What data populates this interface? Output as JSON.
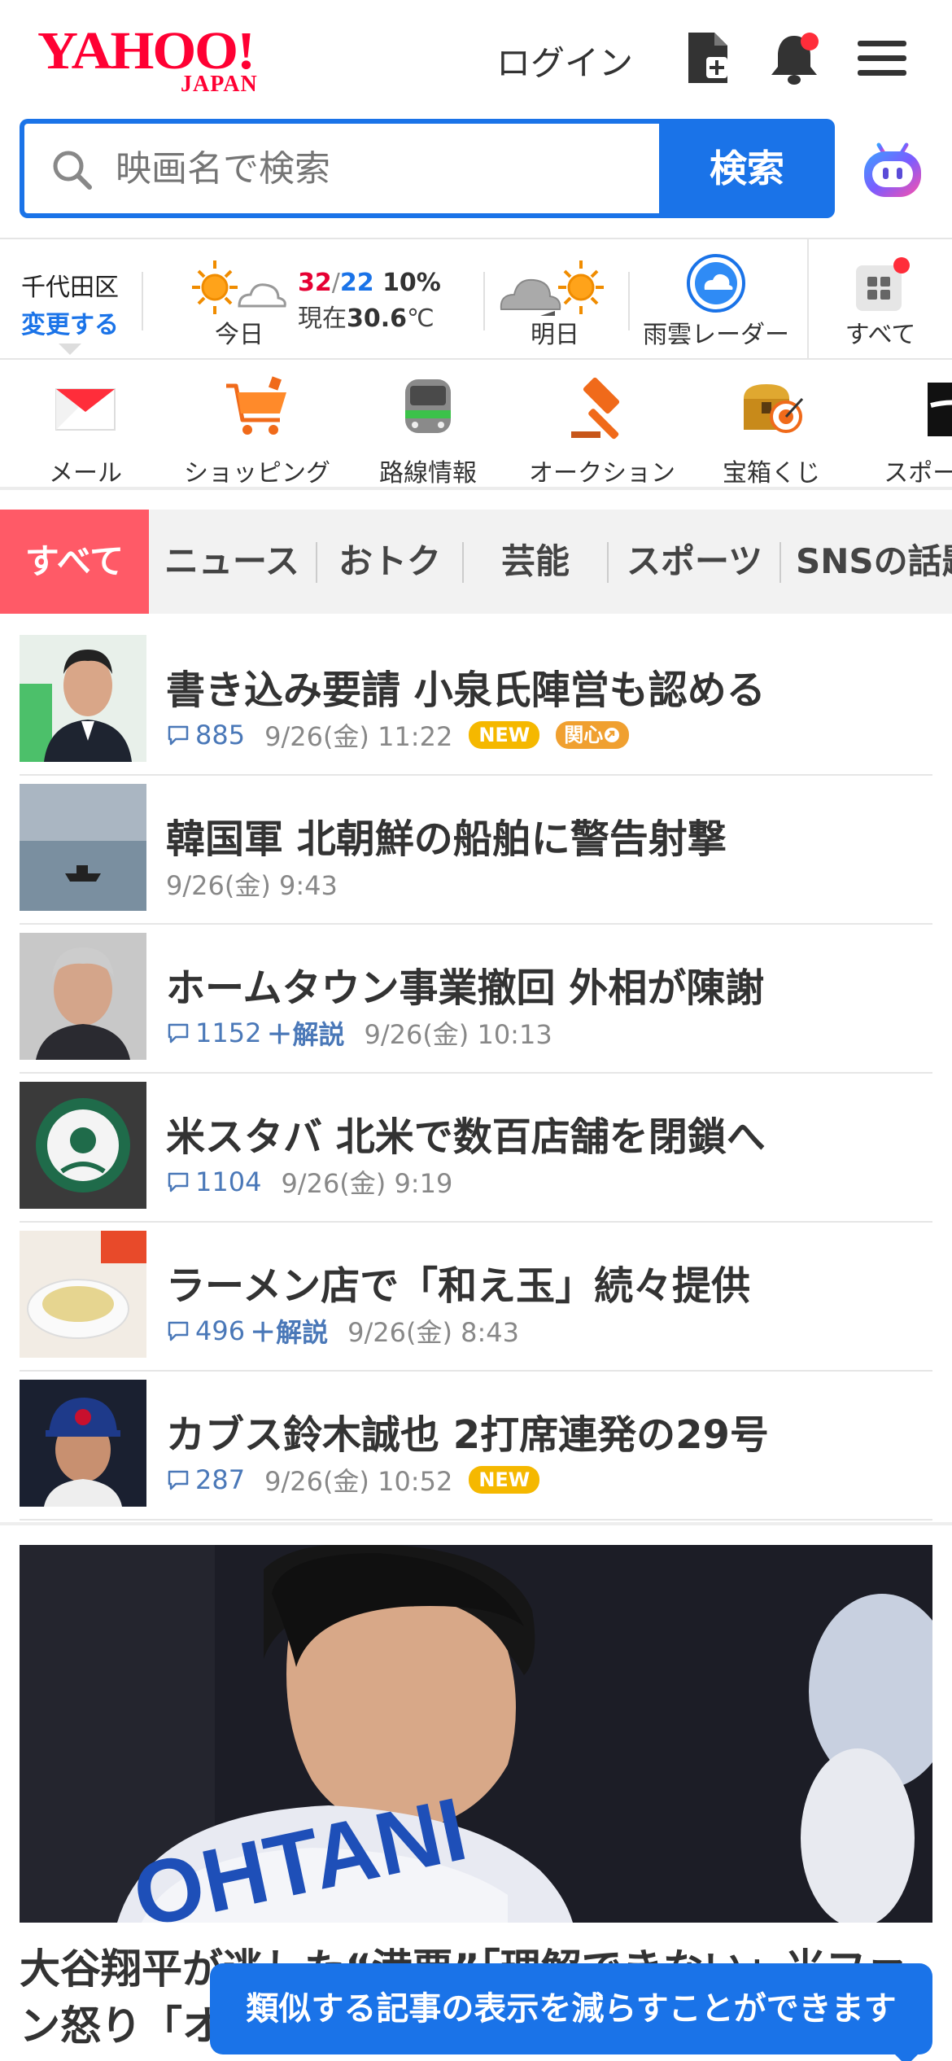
{
  "header": {
    "logo_main": "YAHOO!",
    "logo_sub": "JAPAN",
    "login_label": "ログイン"
  },
  "search": {
    "placeholder": "映画名で検索",
    "button_label": "検索"
  },
  "weather": {
    "location": "千代田区",
    "change_label": "変更する",
    "today_label": "今日",
    "high": "32",
    "separator": "/",
    "low": "22",
    "rain": "10%",
    "now_prefix": "現在",
    "now_temp": "30.6",
    "unit": "℃",
    "tomorrow_label": "明日",
    "radar_label": "雨雲レーダー",
    "all_label": "すべて"
  },
  "services": [
    {
      "label": "メール",
      "icon": "mail-icon"
    },
    {
      "label": "ショッピング",
      "icon": "cart-icon"
    },
    {
      "label": "路線情報",
      "icon": "train-icon"
    },
    {
      "label": "オークション",
      "icon": "hammer-icon"
    },
    {
      "label": "宝箱くじ",
      "icon": "treasure-icon"
    },
    {
      "label": "スポーツ",
      "icon": "sports-icon"
    }
  ],
  "tabs": [
    "すべて",
    "ニュース",
    "おトク",
    "芸能",
    "スポーツ",
    "SNSの話題"
  ],
  "news": [
    {
      "title": "書き込み要請 小泉氏陣営も認める",
      "comments": "885",
      "kaisetsu": "",
      "date": "9/26(金) 11:22",
      "badge_new": "NEW",
      "badge_kanshin": "関心"
    },
    {
      "title": "韓国軍 北朝鮮の船舶に警告射撃",
      "comments": "",
      "kaisetsu": "",
      "date": "9/26(金) 9:43",
      "badge_new": "",
      "badge_kanshin": ""
    },
    {
      "title": "ホームタウン事業撤回 外相が陳謝",
      "comments": "1152",
      "kaisetsu": "＋解説",
      "date": "9/26(金) 10:13",
      "badge_new": "",
      "badge_kanshin": ""
    },
    {
      "title": "米スタバ 北米で数百店舗を閉鎖へ",
      "comments": "1104",
      "kaisetsu": "",
      "date": "9/26(金) 9:19",
      "badge_new": "",
      "badge_kanshin": ""
    },
    {
      "title": "ラーメン店で「和え玉」続々提供",
      "comments": "496",
      "kaisetsu": "＋解説",
      "date": "9/26(金) 8:43",
      "badge_new": "",
      "badge_kanshin": ""
    },
    {
      "title": "カブス鈴木誠也 2打席連発の29号",
      "comments": "287",
      "kaisetsu": "",
      "date": "9/26(金) 10:52",
      "badge_new": "NEW",
      "badge_kanshin": ""
    }
  ],
  "feature": {
    "jersey_text": "OHTANI",
    "title": "大谷翔平が逃した“満票”「理解できない」米ファン怒り「オ"
  },
  "toast": "類似する記事の表示を減らすことができます",
  "colors": {
    "brand_red": "#ff0033",
    "accent_blue": "#1a73e8",
    "tab_active": "#ff5a67",
    "new_badge": "#f5b800"
  }
}
